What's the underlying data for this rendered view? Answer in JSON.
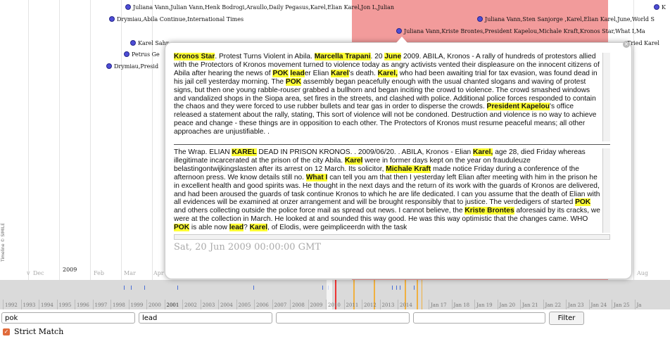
{
  "timeline": {
    "branding": "Timeline © SIMILE",
    "events": [
      "Juliana Vann,Julian Vann,Henk Bodrogi,Araullo,Daily Pegasus,Karel,Elian Karel,Jon L,Julian",
      "Drymiau,Abila Continue,International Times",
      "Juliana Vann,Sten Sanjorge ,Karel,Elian Karel,June,World S",
      "K",
      "Juliana Vann,Kriste Brontes,President Kapelou,Michale Kraft,Kronos Star,What I,Ma",
      "Karel Sahr...",
      "Tried Karel",
      "Petrus Ge",
      "Drymiau,Presid"
    ],
    "year_axis": [
      {
        "label": "v",
        "bold": false
      },
      {
        "label": "Dec",
        "bold": false
      },
      {
        "label": "2009",
        "bold": true
      },
      {
        "label": "Feb",
        "bold": false
      },
      {
        "label": "Mar",
        "bold": false
      },
      {
        "label": "Apr",
        "bold": false
      },
      {
        "label": "Aug",
        "bold": false
      }
    ],
    "overview_labels": [
      {
        "label": "1992",
        "bold": false
      },
      {
        "label": "1993",
        "bold": false
      },
      {
        "label": "1994",
        "bold": false
      },
      {
        "label": "1995",
        "bold": false
      },
      {
        "label": "1996",
        "bold": false
      },
      {
        "label": "1997",
        "bold": false
      },
      {
        "label": "1998",
        "bold": false
      },
      {
        "label": "1999",
        "bold": false
      },
      {
        "label": "2000",
        "bold": false
      },
      {
        "label": "2001",
        "bold": true
      },
      {
        "label": "2002",
        "bold": false
      },
      {
        "label": "2003",
        "bold": false
      },
      {
        "label": "2004",
        "bold": false
      },
      {
        "label": "2005",
        "bold": false
      },
      {
        "label": "2006",
        "bold": false
      },
      {
        "label": "2007",
        "bold": false
      },
      {
        "label": "2008",
        "bold": false
      },
      {
        "label": "2009",
        "bold": false
      },
      {
        "label": "2010",
        "bold": false
      },
      {
        "label": "2011",
        "bold": false
      },
      {
        "label": "2012",
        "bold": false
      },
      {
        "label": "2013",
        "bold": false
      },
      {
        "label": "2014",
        "bold": false
      },
      {
        "label": "Jan 17",
        "bold": false
      },
      {
        "label": "Jan 18",
        "bold": false
      },
      {
        "label": "Jan 19",
        "bold": false
      },
      {
        "label": "Jan 20",
        "bold": false
      },
      {
        "label": "Jan 21",
        "bold": false
      },
      {
        "label": "Jan 22",
        "bold": false
      },
      {
        "label": "Jan 23",
        "bold": false
      },
      {
        "label": "Jan 24",
        "bold": false
      },
      {
        "label": "Jan 25",
        "bold": false
      },
      {
        "label": "Ja",
        "bold": false
      }
    ],
    "colors": {
      "highlight": "#f08a8a",
      "event_dot": "#4d4dd6",
      "marker_red": "#e33",
      "marker_orange": "#f0b040"
    }
  },
  "popup": {
    "close_icon": "close-icon",
    "article1": [
      {
        "t": "Kronos Star",
        "h": true
      },
      {
        "t": ". Protest Turns Violent in Abila. ",
        "h": false
      },
      {
        "t": "Marcella Trapani",
        "h": true
      },
      {
        "t": ". 20 ",
        "h": false
      },
      {
        "t": "June",
        "h": true
      },
      {
        "t": " 2009. ABILA, Kronos - A rally of hundreds of protestors allied with the Protectors of Kronos movement turned to violence today as angry activists vented their displeasure on the innocent citizens of Abila after hearing the news of ",
        "h": false
      },
      {
        "t": "POK",
        "h": true
      },
      {
        "t": " ",
        "h": false
      },
      {
        "t": "lead",
        "h": true
      },
      {
        "t": "er Elian ",
        "h": false
      },
      {
        "t": "Karel",
        "h": true
      },
      {
        "t": "'s death. ",
        "h": false
      },
      {
        "t": "Karel,",
        "h": true
      },
      {
        "t": " who had been awaiting trial for tax evasion, was found dead in his jail cell yesterday morning. The ",
        "h": false
      },
      {
        "t": "POK",
        "h": true
      },
      {
        "t": " assembly began peacefully enough with the usual chanted slogans and waving of protest signs, but then one young rabble-rouser grabbed a bullhorn and began inciting the crowd to violence. The crowd smashed windows and vandalized shops in the Siopa area, set fires in the streets, and clashed with police. Additional police forces responded to contain the chaos and they were forced to use rubber bullets and tear gas in order to disperse the crowds. ",
        "h": false
      },
      {
        "t": "President Kapelou",
        "h": true
      },
      {
        "t": "'s office released a statement about the rally, stating, This sort of violence will not be condoned. Destruction and violence is no way to achieve peace and change - these things are in opposition to each other. The Protectors of Kronos must resume peaceful means; all other approaches are unjustifiable. .",
        "h": false
      }
    ],
    "article2": [
      {
        "t": "The Wrap. ELIAN ",
        "h": false
      },
      {
        "t": "KAREL",
        "h": true
      },
      {
        "t": " DEAD IN PRISON KRONOS. . 2009/06/20. . ABILA, Kronos - Elian ",
        "h": false
      },
      {
        "t": "Karel,",
        "h": true
      },
      {
        "t": " age 28, died Friday whereas illegitimate incarcerated at the prison of the city Abila. ",
        "h": false
      },
      {
        "t": "Karel",
        "h": true
      },
      {
        "t": " were in former days kept on the year on frauduleuze belastingontwijkingslasten after its arrest on 12 March. Its solicitor, ",
        "h": false
      },
      {
        "t": "Michale Kraft",
        "h": true
      },
      {
        "t": " made notice Friday during a conference of the afternoon press. We know details still no. ",
        "h": false
      },
      {
        "t": "What I",
        "h": true
      },
      {
        "t": " can tell you am that then I yesterday left Elian after meeting with him in the prison he in excellent health and good spirits was. He thought in the next days and the return of its work with the guards of Kronos are delivered, and had been aroused the guards of task continue Kronos to which he are life dedicated. I can you assume that the death of Elian with all evidences will be examined at onzer arrangement and will be brought responsibly that to justice. The verdedigers of started ",
        "h": false
      },
      {
        "t": "POK",
        "h": true
      },
      {
        "t": " and others collecting outside the police force mail as spread out news. I cannot believe, the ",
        "h": false
      },
      {
        "t": "Kriste Brontes",
        "h": true
      },
      {
        "t": " aforesaid by its cracks, we were at the collection in March. He looked at and sounded this way good. He was this way optimistic that the changes came. WHO ",
        "h": false
      },
      {
        "t": "POK",
        "h": true
      },
      {
        "t": " is able now ",
        "h": false
      },
      {
        "t": "lead",
        "h": true
      },
      {
        "t": "? ",
        "h": false
      },
      {
        "t": "Karel",
        "h": true
      },
      {
        "t": ", of Elodis, were geimpliceerdn with the task",
        "h": false
      }
    ],
    "date": "Sat, 20 Jun 2009 00:00:00 GMT",
    "highlight_color": "#ffff33"
  },
  "filters": {
    "input1_value": "pok",
    "input2_value": "lead",
    "input3_value": "",
    "input4_value": "",
    "button_label": "Filter"
  },
  "strict_match": {
    "label": "Strict Match",
    "checked": true
  }
}
